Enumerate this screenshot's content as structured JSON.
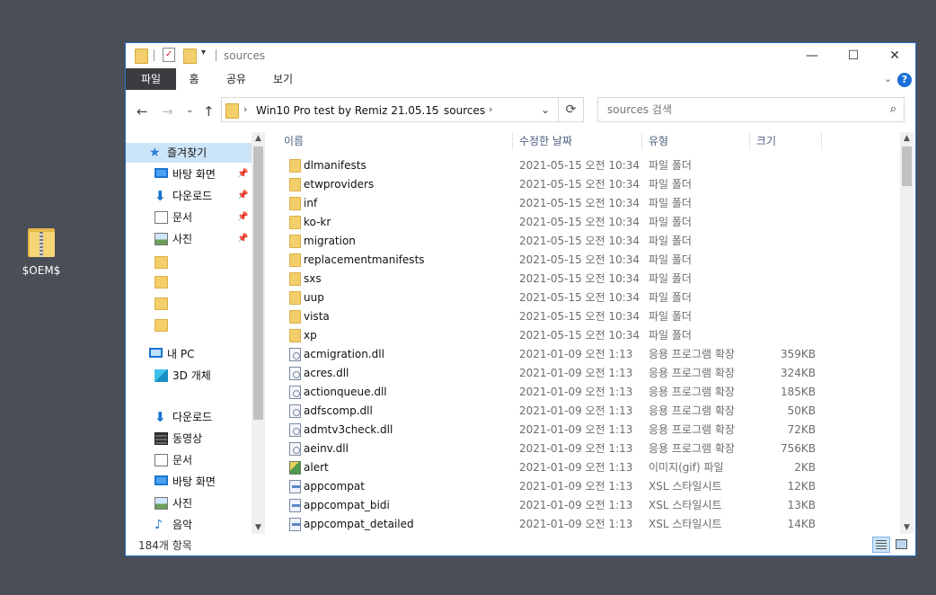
{
  "desktop": {
    "icon_label": "$OEM$"
  },
  "window": {
    "title": "sources",
    "controls": {
      "minimize": "—",
      "maximize": "☐",
      "close": "✕"
    }
  },
  "ribbon": {
    "tabs": [
      "파일",
      "홈",
      "공유",
      "보기"
    ],
    "help": "?"
  },
  "address": {
    "crumbs": [
      "Win10 Pro test by Remiz 21.05.15",
      "sources"
    ]
  },
  "search": {
    "placeholder": "sources 검색"
  },
  "nav": {
    "items": [
      {
        "label": "즐겨찾기",
        "icon": "star-icon",
        "selected": true
      },
      {
        "label": "바탕 화면",
        "icon": "desktop-icon",
        "pinned": true
      },
      {
        "label": "다운로드",
        "icon": "download-icon",
        "pinned": true
      },
      {
        "label": "문서",
        "icon": "document-icon",
        "pinned": true
      },
      {
        "label": "사진",
        "icon": "picture-icon",
        "pinned": true
      },
      {
        "label": "",
        "icon": "folder-icon"
      },
      {
        "label": "",
        "icon": "folder-icon"
      },
      {
        "label": "",
        "icon": "folder-icon"
      },
      {
        "label": "",
        "icon": "folder-icon"
      },
      {
        "label": "내 PC",
        "icon": "computer-icon"
      },
      {
        "label": "3D 개체",
        "icon": "cube-icon"
      },
      {
        "label": "다운로드",
        "icon": "download-icon"
      },
      {
        "label": "동영상",
        "icon": "video-icon"
      },
      {
        "label": "문서",
        "icon": "document-icon"
      },
      {
        "label": "바탕 화면",
        "icon": "desktop-icon"
      },
      {
        "label": "사진",
        "icon": "picture-icon"
      },
      {
        "label": "음악",
        "icon": "music-icon"
      }
    ]
  },
  "columns": {
    "name": "이름",
    "date": "수정한 날짜",
    "type": "유형",
    "size": "크기"
  },
  "files": [
    {
      "name": "dlmanifests",
      "date": "2021-05-15 오전 10:34",
      "type": "파일 폴더",
      "size": "",
      "icon": "folder"
    },
    {
      "name": "etwproviders",
      "date": "2021-05-15 오전 10:34",
      "type": "파일 폴더",
      "size": "",
      "icon": "folder"
    },
    {
      "name": "inf",
      "date": "2021-05-15 오전 10:34",
      "type": "파일 폴더",
      "size": "",
      "icon": "folder"
    },
    {
      "name": "ko-kr",
      "date": "2021-05-15 오전 10:34",
      "type": "파일 폴더",
      "size": "",
      "icon": "folder"
    },
    {
      "name": "migration",
      "date": "2021-05-15 오전 10:34",
      "type": "파일 폴더",
      "size": "",
      "icon": "folder"
    },
    {
      "name": "replacementmanifests",
      "date": "2021-05-15 오전 10:34",
      "type": "파일 폴더",
      "size": "",
      "icon": "folder"
    },
    {
      "name": "sxs",
      "date": "2021-05-15 오전 10:34",
      "type": "파일 폴더",
      "size": "",
      "icon": "folder"
    },
    {
      "name": "uup",
      "date": "2021-05-15 오전 10:34",
      "type": "파일 폴더",
      "size": "",
      "icon": "folder"
    },
    {
      "name": "vista",
      "date": "2021-05-15 오전 10:34",
      "type": "파일 폴더",
      "size": "",
      "icon": "folder"
    },
    {
      "name": "xp",
      "date": "2021-05-15 오전 10:34",
      "type": "파일 폴더",
      "size": "",
      "icon": "folder"
    },
    {
      "name": "acmigration.dll",
      "date": "2021-01-09 오전 1:13",
      "type": "응용 프로그램 확장",
      "size": "359KB",
      "icon": "dll"
    },
    {
      "name": "acres.dll",
      "date": "2021-01-09 오전 1:13",
      "type": "응용 프로그램 확장",
      "size": "324KB",
      "icon": "dll"
    },
    {
      "name": "actionqueue.dll",
      "date": "2021-01-09 오전 1:13",
      "type": "응용 프로그램 확장",
      "size": "185KB",
      "icon": "dll"
    },
    {
      "name": "adfscomp.dll",
      "date": "2021-01-09 오전 1:13",
      "type": "응용 프로그램 확장",
      "size": "50KB",
      "icon": "dll"
    },
    {
      "name": "admtv3check.dll",
      "date": "2021-01-09 오전 1:13",
      "type": "응용 프로그램 확장",
      "size": "72KB",
      "icon": "dll"
    },
    {
      "name": "aeinv.dll",
      "date": "2021-01-09 오전 1:13",
      "type": "응용 프로그램 확장",
      "size": "756KB",
      "icon": "dll"
    },
    {
      "name": "alert",
      "date": "2021-01-09 오전 1:13",
      "type": "이미지(gif) 파일",
      "size": "2KB",
      "icon": "gif"
    },
    {
      "name": "appcompat",
      "date": "2021-01-09 오전 1:13",
      "type": "XSL 스타일시트",
      "size": "12KB",
      "icon": "xsl"
    },
    {
      "name": "appcompat_bidi",
      "date": "2021-01-09 오전 1:13",
      "type": "XSL 스타일시트",
      "size": "13KB",
      "icon": "xsl"
    },
    {
      "name": "appcompat_detailed",
      "date": "2021-01-09 오전 1:13",
      "type": "XSL 스타일시트",
      "size": "14KB",
      "icon": "xsl"
    }
  ],
  "status": {
    "item_count": "184개 항목"
  },
  "colors": {
    "accent": "#1a74d0",
    "selection": "#cce4f7",
    "file_tab": "#3a3c40",
    "folder": "#f3cf6b"
  }
}
